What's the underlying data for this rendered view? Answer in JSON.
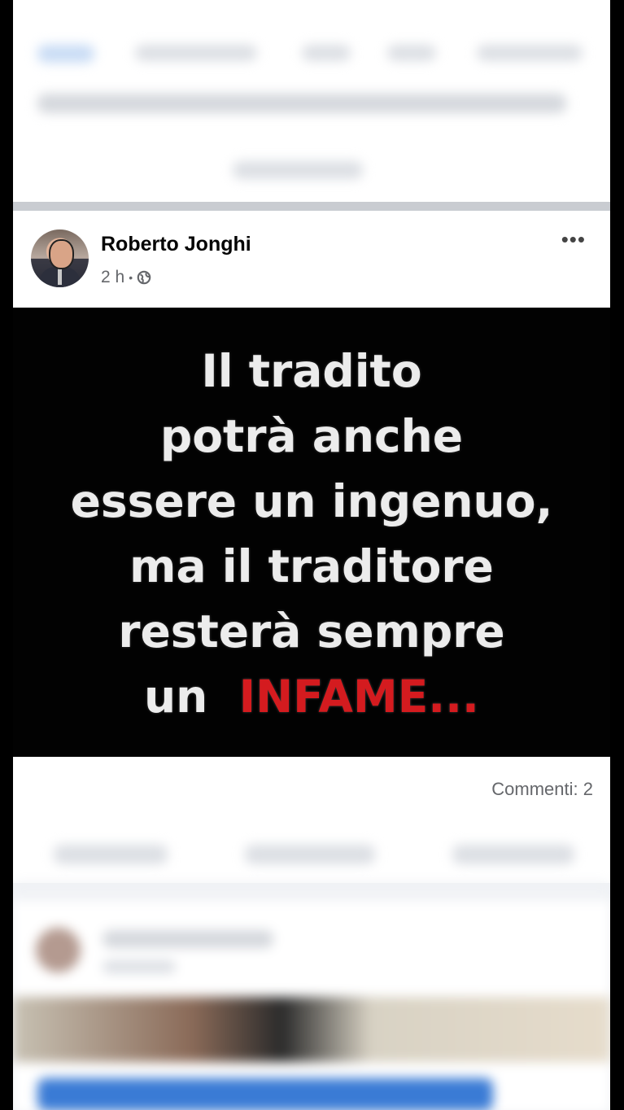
{
  "post": {
    "author": "Roberto Jonghi",
    "time": "2 h",
    "dot": "•",
    "privacy_icon": "globe-icon",
    "more_icon": "•••",
    "quote_lines": [
      "Il tradito",
      "potrà anche",
      "essere un ingenuo,",
      "ma il traditore",
      "resterà sempre"
    ],
    "quote_last_prefix": "un",
    "quote_last_highlight": "INFAME...",
    "highlight_color": "#d41b1f",
    "comments_count": "Commenti: 2"
  }
}
